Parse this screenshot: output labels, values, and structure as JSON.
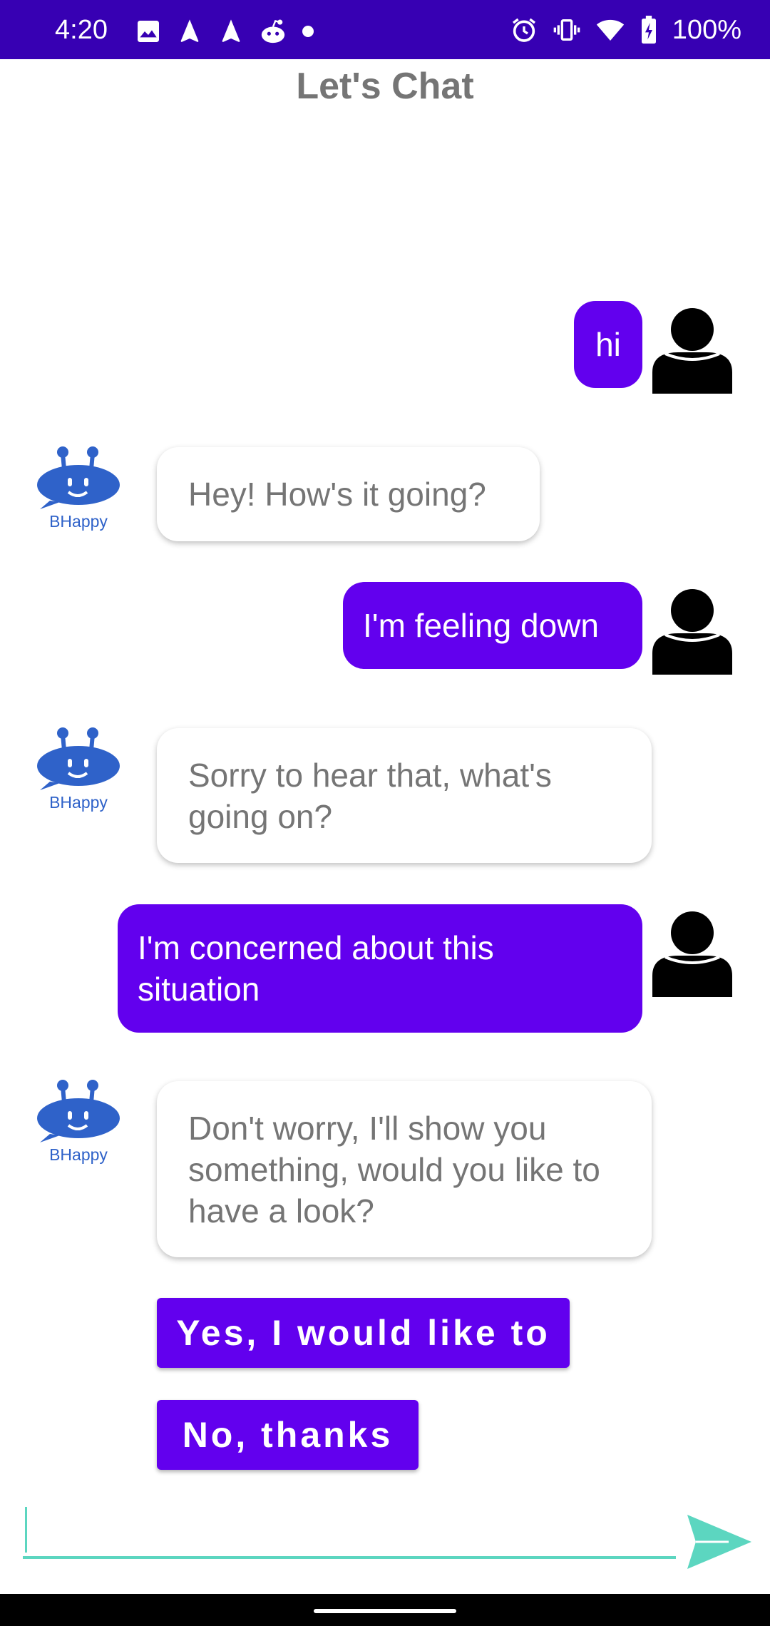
{
  "status_bar": {
    "time": "4:20",
    "left_icons": [
      "image-icon",
      "navigation-icon",
      "navigation-icon",
      "reddit-icon",
      "dot-icon"
    ],
    "right_icons": [
      "alarm-icon",
      "vibrate-icon",
      "wifi-icon",
      "battery-charging-icon"
    ],
    "battery": "100%",
    "color": "#3700b3"
  },
  "header": {
    "title": "Let's Chat"
  },
  "bot": {
    "name": "BHappy"
  },
  "messages": [
    {
      "sender": "user",
      "text": "hi"
    },
    {
      "sender": "bot",
      "text": "Hey! How's it going?"
    },
    {
      "sender": "user",
      "text": "I'm feeling down"
    },
    {
      "sender": "bot",
      "text": "Sorry to hear that, what's going on?"
    },
    {
      "sender": "user",
      "text": "I'm concerned about this situation"
    },
    {
      "sender": "bot",
      "text": "Don't worry, I'll show you something, would you like to have a look?"
    }
  ],
  "choices": [
    {
      "label": "Yes, I would like to"
    },
    {
      "label": "No, thanks"
    }
  ],
  "input": {
    "placeholder": "",
    "value": ""
  },
  "colors": {
    "user_bubble": "#6200ee",
    "accent": "#5cd6c0",
    "bot_icon": "#2f62c9",
    "bot_text": "#757575"
  }
}
